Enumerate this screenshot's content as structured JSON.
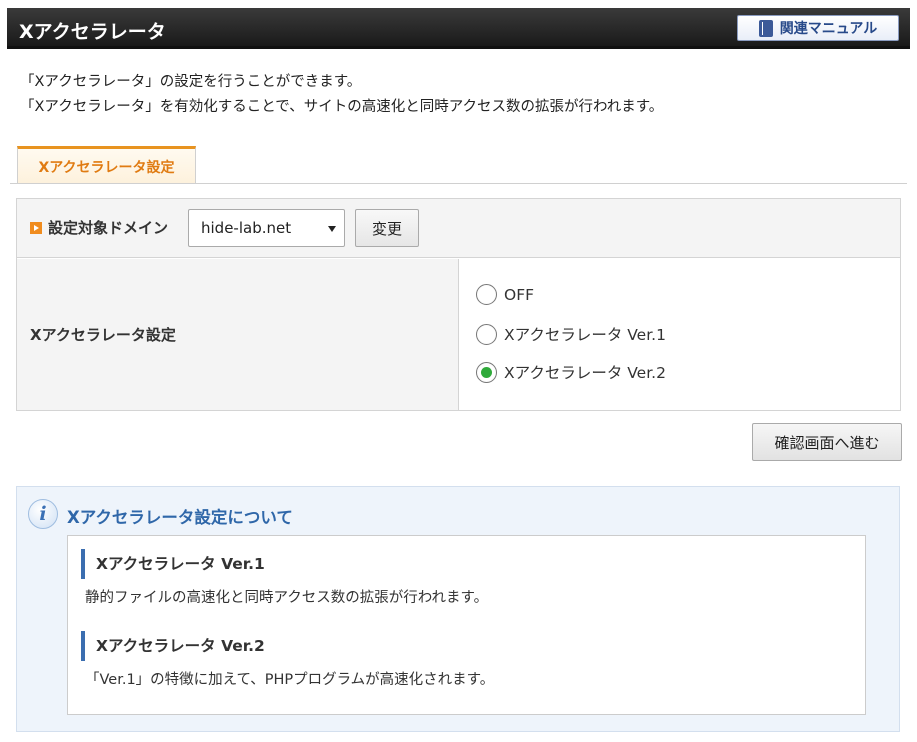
{
  "header": {
    "title": "Xアクセラレータ",
    "manual_label": "関連マニュアル"
  },
  "intro": {
    "line1": "「Xアクセラレータ」の設定を行うことができます。",
    "line2": "「Xアクセラレータ」を有効化することで、サイトの高速化と同時アクセス数の拡張が行われます。"
  },
  "tab": {
    "label": "Xアクセラレータ設定"
  },
  "settings": {
    "domain_label": "設定対象ドメイン",
    "domain_value": "hide-lab.net",
    "change_label": "変更",
    "row_label": "Xアクセラレータ設定",
    "options": [
      {
        "label": "OFF",
        "checked": false
      },
      {
        "label": "Xアクセラレータ Ver.1",
        "checked": false
      },
      {
        "label": "Xアクセラレータ Ver.2",
        "checked": true
      }
    ]
  },
  "confirm_label": "確認画面へ進む",
  "info": {
    "title": "Xアクセラレータ設定について",
    "items": [
      {
        "heading": "Xアクセラレータ Ver.1",
        "desc": "静的ファイルの高速化と同時アクセス数の拡張が行われます。"
      },
      {
        "heading": "Xアクセラレータ Ver.2",
        "desc": "「Ver.1」の特徴に加えて、PHPプログラムが高速化されます。"
      }
    ]
  },
  "colors": {
    "accent_orange": "#e8931f",
    "radio_checked": "#2faa3a",
    "info_blue": "#2f67a9"
  }
}
